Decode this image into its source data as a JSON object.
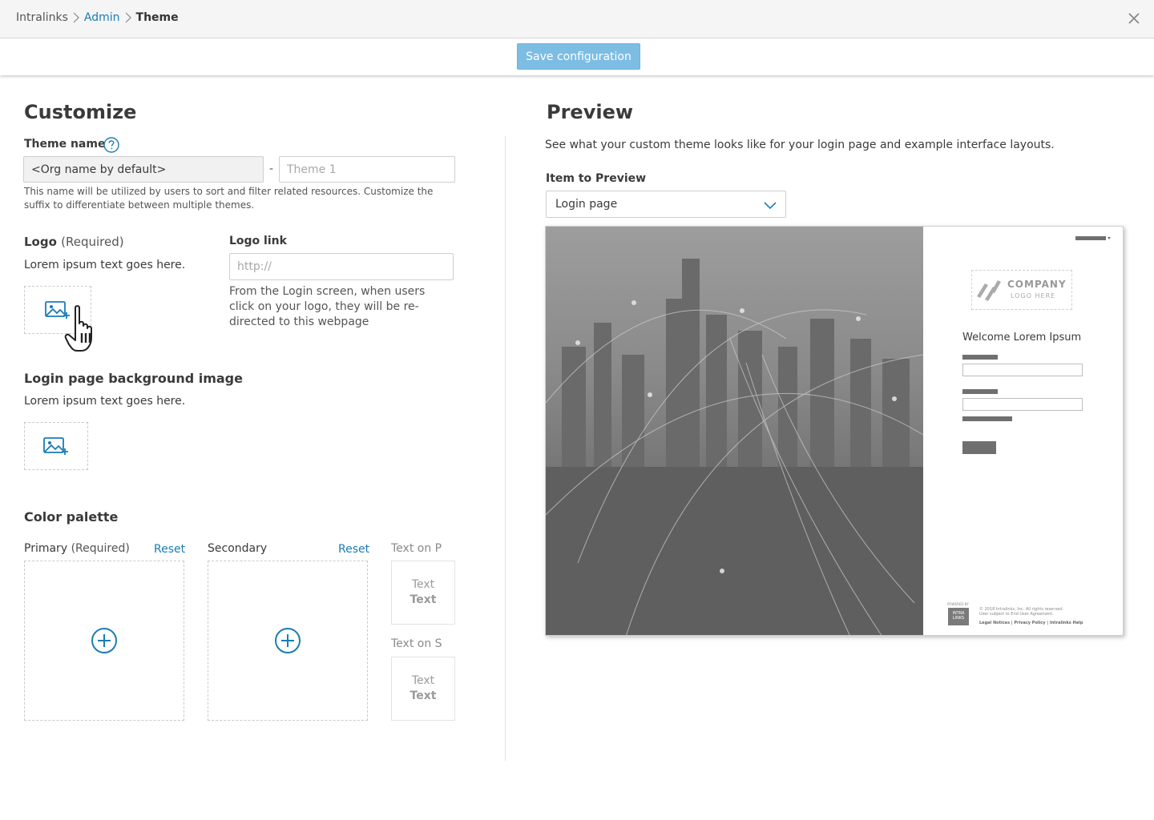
{
  "breadcrumb": {
    "root": "Intralinks",
    "admin": "Admin",
    "current": "Theme"
  },
  "toolbar": {
    "save_label": "Save configuration"
  },
  "customize": {
    "title": "Customize",
    "theme_name": {
      "label": "Theme name",
      "prefix_value": "<Org name by default>",
      "separator": "-",
      "suffix_placeholder": "Theme 1",
      "help": "This name will be utilized by users to sort and filter related resources. Customize the suffix to differentiate between multiple themes."
    },
    "logo": {
      "label": "Logo",
      "required": "(Required)",
      "desc": "Lorem ipsum text goes here."
    },
    "logo_link": {
      "label": "Logo link",
      "placeholder": "http://",
      "help": "From the Login screen, when users click on your logo, they will be re-directed to this webpage"
    },
    "background": {
      "label": "Login page background image",
      "desc": "Lorem ipsum text goes here."
    },
    "palette": {
      "label": "Color palette",
      "primary": {
        "label": "Primary",
        "required": "(Required)",
        "reset": "Reset"
      },
      "secondary": {
        "label": "Secondary",
        "reset": "Reset"
      },
      "text_on_primary": {
        "label": "Text on P",
        "sample": "Text",
        "sample_bold": "Text"
      },
      "text_on_secondary": {
        "label": "Text on S",
        "sample": "Text",
        "sample_bold": "Text"
      }
    }
  },
  "preview": {
    "title": "Preview",
    "desc": "See what your custom theme looks like for your login page and example interface layouts.",
    "item_label": "Item to Preview",
    "item_value": "Login page",
    "mock": {
      "logo_title": "COMPANY",
      "logo_sub": "LOGO HERE",
      "welcome": "Welcome Lorem Ipsum",
      "powered": "POWERED BY",
      "footer_logo": "INTRA LINKS",
      "copyright": "© 2018 Intralinks, Inc. All rights reserved.",
      "agreement": "User subject to End User Agreement.",
      "links": "Legal Notices  |  Privacy Policy  |  Intralinks Help"
    }
  },
  "colors": {
    "accent": "#1b7cb4",
    "save_button": "#7cbde4"
  }
}
